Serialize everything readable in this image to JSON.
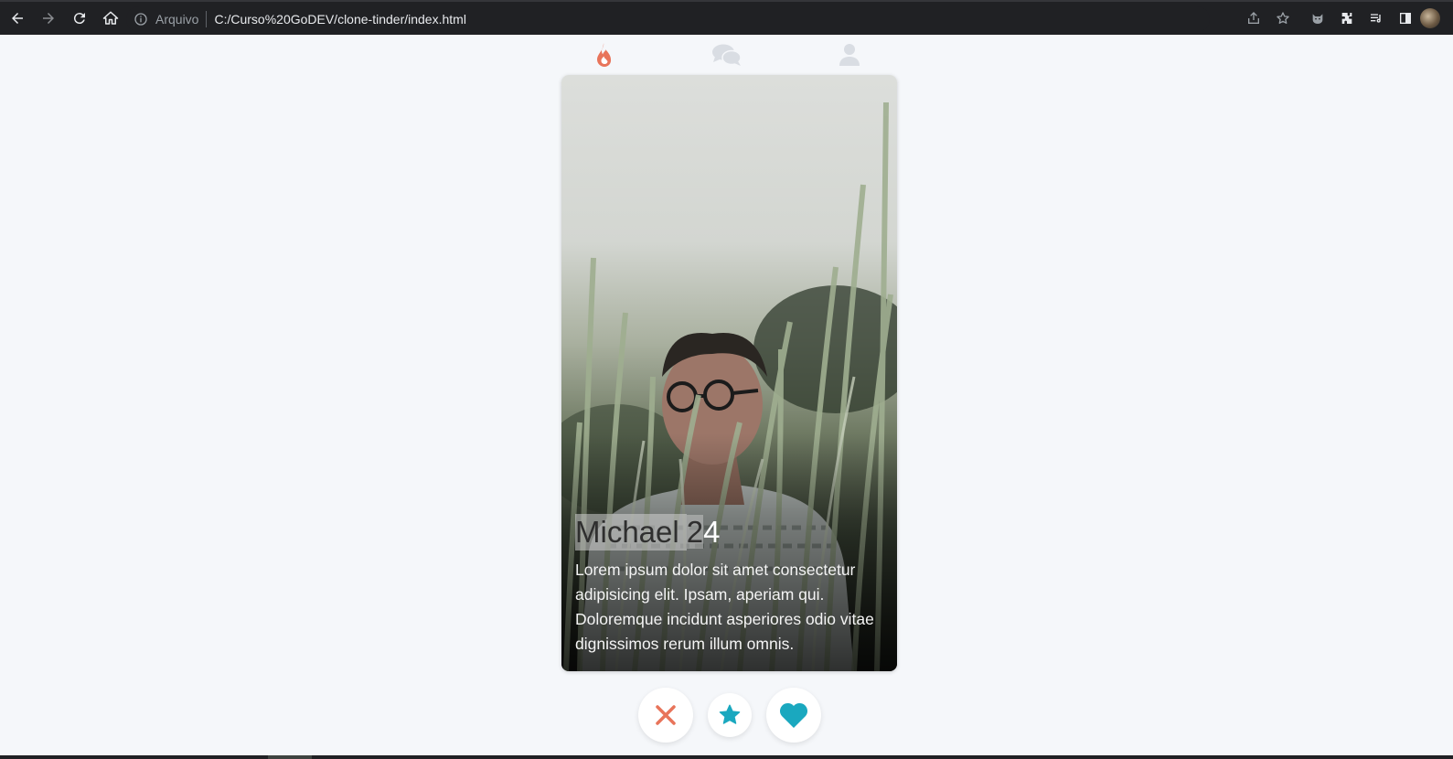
{
  "browser": {
    "scheme_label": "Arquivo",
    "url": "C:/Curso%20GoDEV/clone-tinder/index.html"
  },
  "nav": {
    "tabs": [
      {
        "icon": "flame-icon",
        "active": true,
        "color": "#e8745a"
      },
      {
        "icon": "chat-icon",
        "active": false,
        "color": "#d9dde3"
      },
      {
        "icon": "user-icon",
        "active": false,
        "color": "#d9dde3"
      }
    ]
  },
  "profile": {
    "name": "Michael",
    "age_first": "2",
    "age_rest": "4",
    "bio": "Lorem ipsum dolor sit amet consectetur adipisicing elit. Ipsam, aperiam qui. Doloremque incidunt asperiores odio vitae dignissimos rerum illum omnis."
  },
  "actions": [
    {
      "icon": "close-icon",
      "color": "#e8745a"
    },
    {
      "icon": "star-icon",
      "color": "#1aa8bf"
    },
    {
      "icon": "heart-icon",
      "color": "#1aa8bf"
    }
  ],
  "colors": {
    "page_bg": "#f5f7fa",
    "accent_red": "#e8745a",
    "accent_teal": "#1aa8bf",
    "chrome_bg": "#202124"
  }
}
